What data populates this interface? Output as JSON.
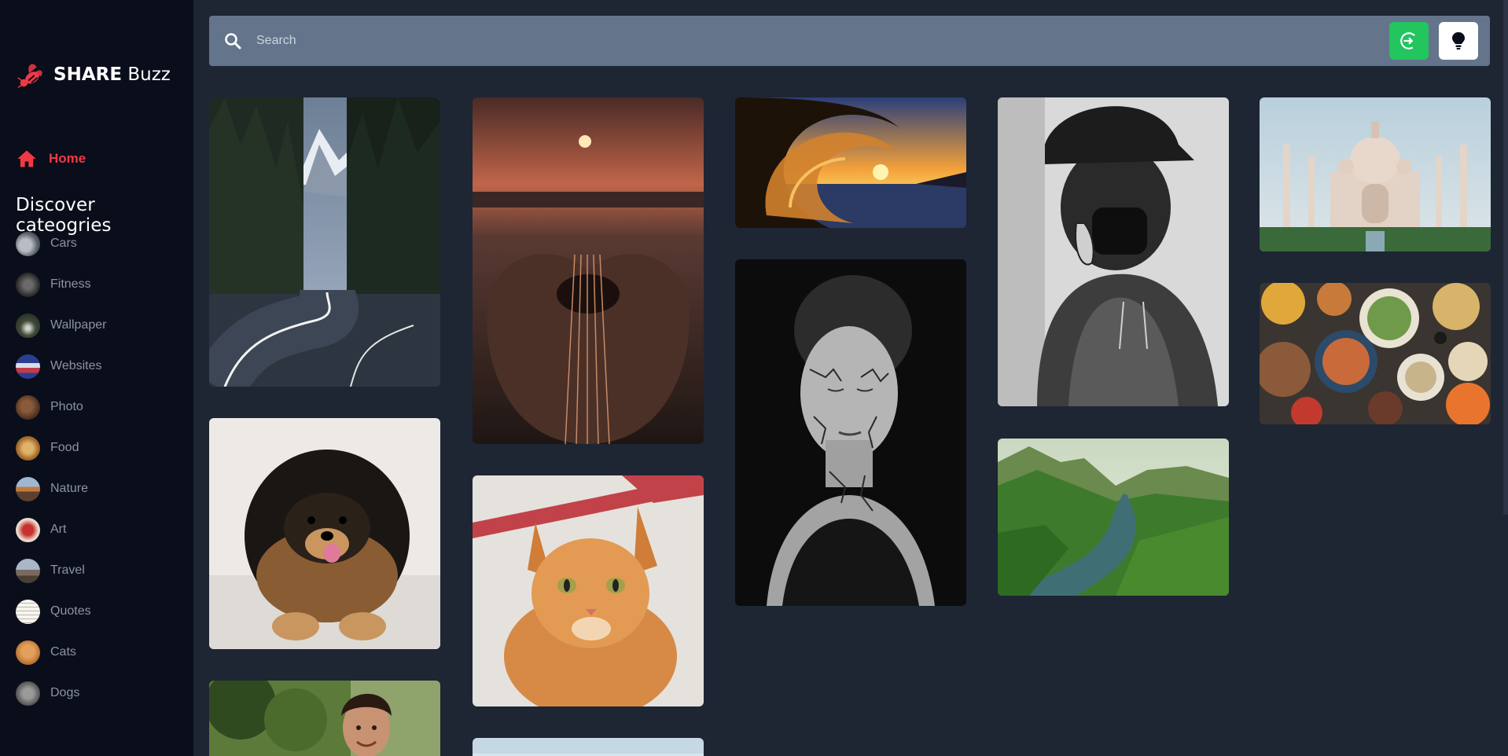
{
  "brand": {
    "name_bold": "SHARE",
    "name_light": "Buzz",
    "logo_icon": "bee-logo-icon",
    "accent": "#ef3a45"
  },
  "nav": {
    "home_label": "Home",
    "home_icon": "home-icon"
  },
  "categories_title": "Discover cateogries",
  "categories": [
    {
      "label": "Cars"
    },
    {
      "label": "Fitness"
    },
    {
      "label": "Wallpaper"
    },
    {
      "label": "Websites"
    },
    {
      "label": "Photo"
    },
    {
      "label": "Food"
    },
    {
      "label": "Nature"
    },
    {
      "label": "Art"
    },
    {
      "label": "Travel"
    },
    {
      "label": "Quotes"
    },
    {
      "label": "Cats"
    },
    {
      "label": "Dogs"
    }
  ],
  "search": {
    "placeholder": "Search",
    "icon": "search-icon"
  },
  "actions": {
    "login_icon": "login-icon",
    "login_color": "#22c55e",
    "theme_icon": "lightbulb-icon",
    "theme_color": "#ffffff"
  },
  "pins": [
    {
      "subject": "mountain-road"
    },
    {
      "subject": "pomeranian-dog"
    },
    {
      "subject": "boy-portrait"
    },
    {
      "subject": "guitar-sunset"
    },
    {
      "subject": "orange-cat"
    },
    {
      "subject": "sky-partial"
    },
    {
      "subject": "wave-sunset"
    },
    {
      "subject": "face-art-bw"
    },
    {
      "subject": "anime-hoodie"
    },
    {
      "subject": "river-valley"
    },
    {
      "subject": "taj-mahal"
    },
    {
      "subject": "food-spread"
    }
  ]
}
